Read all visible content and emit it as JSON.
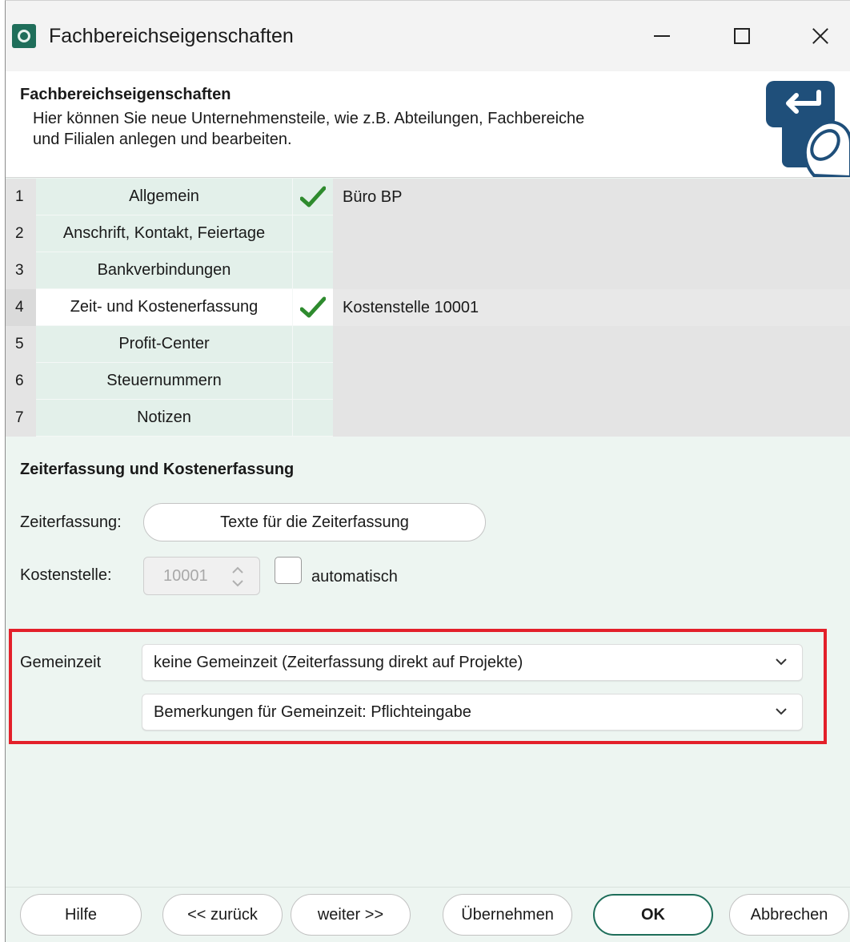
{
  "window": {
    "title": "Fachbereichseigenschaften",
    "accent_color": "#1f6e5a",
    "highlight_color": "#e3202a"
  },
  "header": {
    "title": "Fachbereichseigenschaften",
    "line1": "Hier können Sie neue Unternehmensteile, wie z.B. Abteilungen, Fachbereiche",
    "line2": "und Filialen anlegen und bearbeiten.",
    "graphic_icon": "enter-key-touch-icon"
  },
  "steps": [
    {
      "num": "1",
      "label": "Allgemein",
      "checked": true,
      "value": "Büro BP"
    },
    {
      "num": "2",
      "label": "Anschrift, Kontakt, Feiertage",
      "checked": false,
      "value": ""
    },
    {
      "num": "3",
      "label": "Bankverbindungen",
      "checked": false,
      "value": ""
    },
    {
      "num": "4",
      "label": "Zeit- und Kostenerfassung",
      "checked": true,
      "value": "Kostenstelle 10001",
      "active": true
    },
    {
      "num": "5",
      "label": "Profit-Center",
      "checked": false,
      "value": ""
    },
    {
      "num": "6",
      "label": "Steuernummern",
      "checked": false,
      "value": ""
    },
    {
      "num": "7",
      "label": "Notizen",
      "checked": false,
      "value": ""
    }
  ],
  "section": {
    "title": "Zeiterfassung und Kostenerfassung",
    "zeit_label": "Zeiterfassung:",
    "zeit_button": "Texte für die Zeiterfassung",
    "kosten_label": "Kostenstelle:",
    "kosten_value": "10001",
    "auto_label": "automatisch",
    "auto_checked": false
  },
  "gemeinzeit": {
    "label": "Gemeinzeit",
    "select1": "keine Gemeinzeit (Zeiterfassung direkt auf Projekte)",
    "select2": "Bemerkungen für Gemeinzeit: Pflichteingabe"
  },
  "buttons": {
    "help": "Hilfe",
    "back": "<< zurück",
    "next": "weiter >>",
    "apply": "Übernehmen",
    "ok": "OK",
    "cancel": "Abbrechen"
  }
}
